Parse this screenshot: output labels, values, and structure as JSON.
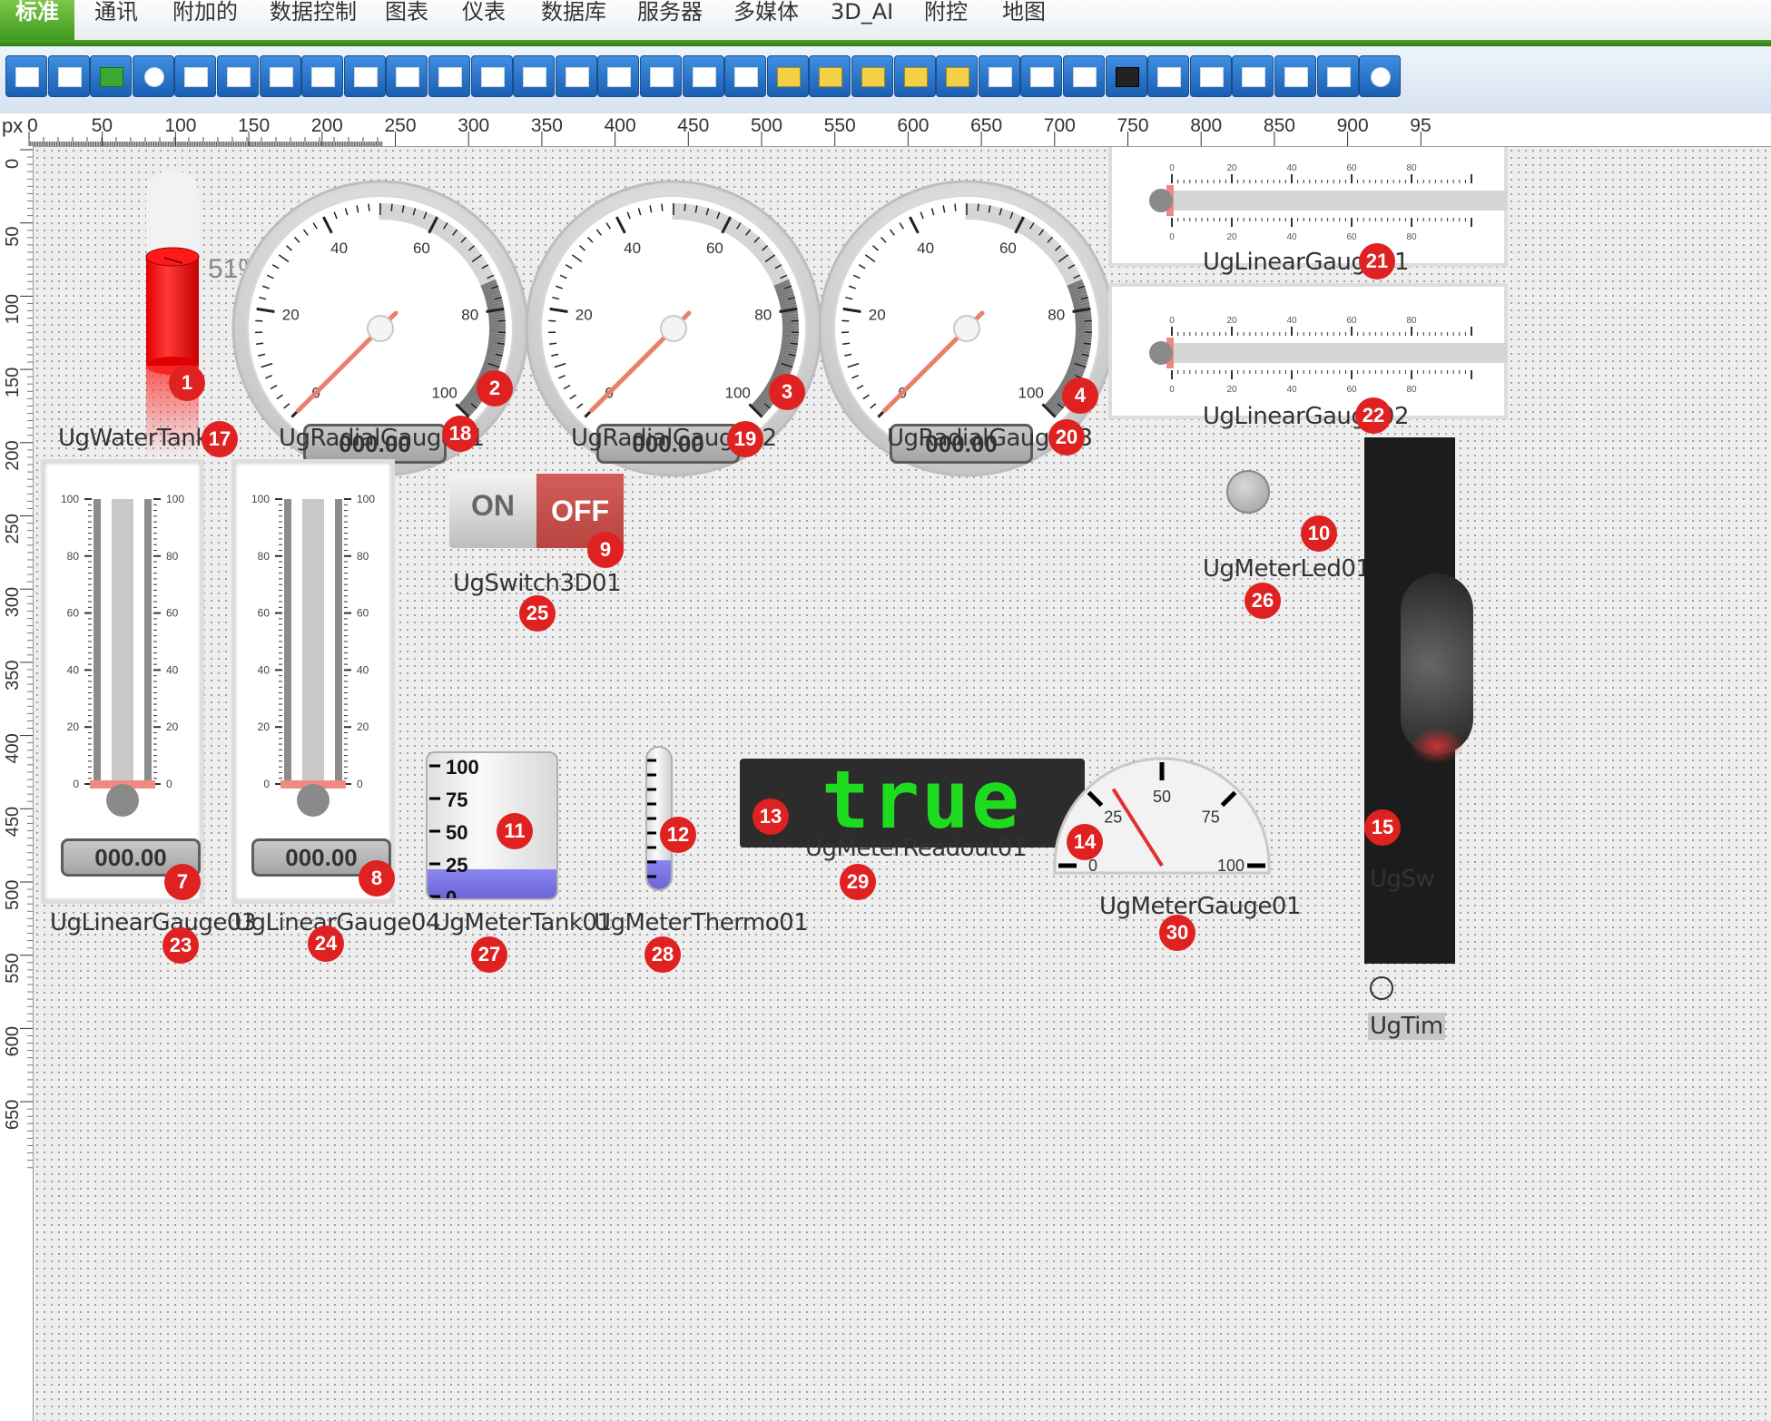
{
  "menu": {
    "tabs": [
      {
        "label": "标准",
        "active": true
      },
      {
        "label": "通讯"
      },
      {
        "label": "附加的"
      },
      {
        "label": "数据控制"
      },
      {
        "label": "图表"
      },
      {
        "label": "仪表"
      },
      {
        "label": "数据库"
      },
      {
        "label": "服务器"
      },
      {
        "label": "多媒体"
      },
      {
        "label": "3D_AI"
      },
      {
        "label": "附控"
      },
      {
        "label": "地图"
      }
    ]
  },
  "toolbar": {
    "buttons": [
      "checkbox-group",
      "ok-button",
      "led-strip",
      "radio",
      "checkbox",
      "list",
      "grid-edit",
      "font",
      "textbox",
      "scrollbar",
      "num-edit",
      "date-edit",
      "listbox",
      "memo",
      "table",
      "combo",
      "picture",
      "panel",
      "folder-1",
      "folder-2",
      "folder-3",
      "folder-4",
      "folder-5",
      "frame",
      "groupbox",
      "report",
      "film",
      "image-panel",
      "image",
      "grid",
      "tree",
      "tree-list",
      "timer"
    ]
  },
  "ruler": {
    "unit": "px",
    "h_ticks": [
      "0",
      "50",
      "100",
      "150",
      "200",
      "250",
      "300",
      "350",
      "400",
      "450",
      "500",
      "550",
      "600",
      "650",
      "700",
      "750",
      "800",
      "850",
      "900",
      "95"
    ],
    "v_ticks": [
      "0",
      "50",
      "100",
      "150",
      "200",
      "250",
      "300",
      "350",
      "400",
      "450",
      "500",
      "550",
      "600",
      "650"
    ]
  },
  "controls": {
    "water_tank": {
      "name": "UgWaterTank01",
      "percent": "51%",
      "level": 0.51,
      "badge": "1",
      "name_badge": "17"
    },
    "radial_gauges": [
      {
        "name": "UgRadialGauge01",
        "readout": "000.00",
        "badge": "2",
        "name_badge": "18",
        "ticks": [
          "0",
          "20",
          "40",
          "60",
          "80",
          "100"
        ],
        "value": 0
      },
      {
        "name": "UgRadialGauge02",
        "readout": "000.00",
        "badge": "3",
        "name_badge": "19",
        "ticks": [
          "0",
          "20",
          "40",
          "60",
          "80",
          "100"
        ],
        "value": 0
      },
      {
        "name": "UgRadialGauge03",
        "readout": "000.00",
        "badge": "4",
        "name_badge": "20",
        "ticks": [
          "0",
          "20",
          "40",
          "60",
          "80",
          "100"
        ],
        "value": 0
      }
    ],
    "linear_gauges_h": [
      {
        "name": "UgLinearGauge01",
        "badge": "21",
        "ticks": [
          "0",
          "20",
          "40",
          "60",
          "80"
        ]
      },
      {
        "name": "UgLinearGauge02",
        "badge": "22",
        "ticks": [
          "0",
          "20",
          "40",
          "60",
          "80"
        ]
      }
    ],
    "linear_gauges_v": [
      {
        "name": "UgLinearGauge03",
        "readout": "000.00",
        "badge": "7",
        "name_badge": "23",
        "ticks": [
          "100",
          "80",
          "60",
          "40",
          "20",
          "0"
        ]
      },
      {
        "name": "UgLinearGauge04",
        "readout": "000.00",
        "badge": "8",
        "name_badge": "24",
        "ticks": [
          "100",
          "80",
          "60",
          "40",
          "20",
          "0"
        ]
      }
    ],
    "switch": {
      "name": "UgSwitch3D01",
      "on_label": "ON",
      "off_label": "OFF",
      "badge": "9",
      "name_badge": "25"
    },
    "meter_led": {
      "name": "UgMeterLed01",
      "badge": "10",
      "name_badge": "26"
    },
    "meter_tank": {
      "name": "UgMeterTank01",
      "badge": "11",
      "name_badge": "27",
      "ticks": [
        "100",
        "75",
        "50",
        "25",
        "0"
      ]
    },
    "meter_thermo": {
      "name": "UgMeterThermo01",
      "badge": "12",
      "name_badge": "28"
    },
    "meter_readout": {
      "name": "UgMeterReadout01",
      "text": "true",
      "badge": "13",
      "name_badge": "29"
    },
    "meter_gauge": {
      "name": "UgMeterGauge01",
      "badge": "14",
      "name_badge": "30",
      "ticks": [
        "0",
        "25",
        "50",
        "75",
        "100"
      ]
    },
    "dark_panel": {
      "badge": "15",
      "name_partial": "UgSw"
    },
    "timer": {
      "name_partial": "UgTim"
    }
  },
  "colors": {
    "accent_green": "#3e9a1c",
    "badge_red": "#e02121",
    "tank_red": "#ff0000",
    "readout_green": "#1fdb1f"
  }
}
